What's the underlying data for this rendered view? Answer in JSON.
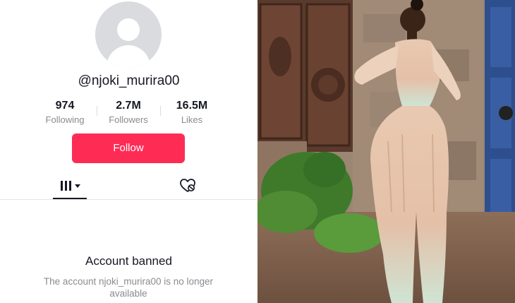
{
  "profile": {
    "username": "@njoki_murira00",
    "follow_label": "Follow"
  },
  "stats": [
    {
      "value": "974",
      "label": "Following"
    },
    {
      "value": "2.7M",
      "label": "Followers"
    },
    {
      "value": "16.5M",
      "label": "Likes"
    }
  ],
  "tabs": [
    {
      "icon": "videos-grid-icon"
    },
    {
      "icon": "liked-heart-icon"
    }
  ],
  "status": {
    "title": "Account banned",
    "message": "The account njoki_murira00 is no longer available"
  },
  "colors": {
    "accent": "#fe2c55",
    "text": "#161823",
    "muted": "#8a8b91"
  }
}
